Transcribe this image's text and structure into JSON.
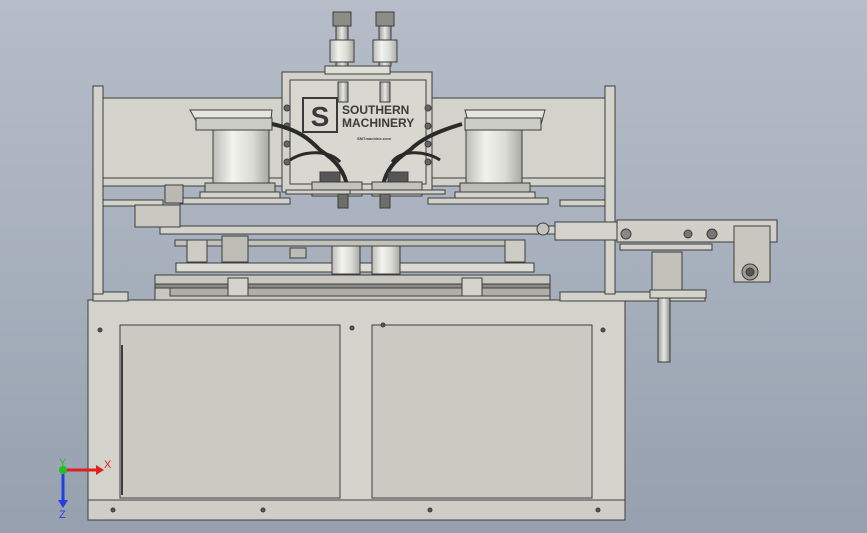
{
  "viewport": {
    "background_top": "#b6bdc8",
    "background_bottom": "#96a0ae"
  },
  "logo": {
    "monogram": "S",
    "line1": "SOUTHERN",
    "line2": "MACHINERY",
    "tagline": "SMTmachine.com"
  },
  "triad": {
    "x_label": "X",
    "y_label": "Y",
    "z_label": "Z",
    "x_color": "#e02020",
    "y_color": "#20c020",
    "z_color": "#2040e0"
  },
  "model_colors": {
    "frame": "#d4d3cb",
    "frame_dark": "#b9b8ae",
    "outline": "#3d3d3d",
    "bowl": "#e6e6e2",
    "hose": "#2a2a2a"
  }
}
